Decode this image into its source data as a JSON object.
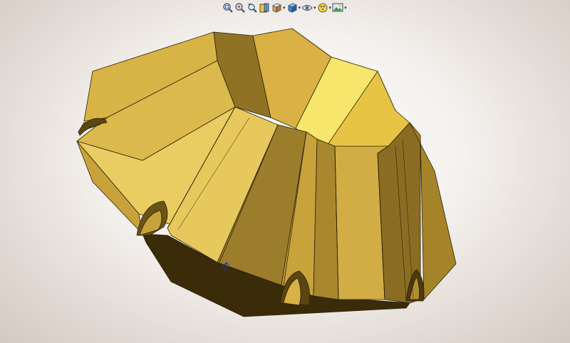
{
  "window": {
    "type": "cad-3d-graphics-area"
  },
  "heads_up_toolbar": {
    "items": [
      {
        "name": "zoom-to-fit-icon",
        "dropdown": false
      },
      {
        "name": "zoom-to-area-icon",
        "dropdown": false
      },
      {
        "name": "previous-view-icon",
        "dropdown": false
      },
      {
        "name": "section-view-icon",
        "dropdown": false
      },
      {
        "name": "view-orientation-icon",
        "dropdown": true
      },
      {
        "name": "display-style-icon",
        "dropdown": true
      },
      {
        "name": "hide-show-items-icon",
        "dropdown": true
      },
      {
        "name": "edit-appearance-icon",
        "dropdown": true
      },
      {
        "name": "apply-scene-icon",
        "dropdown": true
      },
      {
        "name": "view-settings-icon",
        "dropdown": true
      }
    ],
    "dropdown_glyph": "▾"
  },
  "model": {
    "description_color": "#d4aa3a",
    "material_colors": {
      "light": "#f7e66a",
      "mid": "#d9b447",
      "dark": "#8c6f25",
      "darkest": "#3a2c08",
      "edge": "#2a2005"
    }
  },
  "triad": {
    "color": "#1d2fa8"
  }
}
